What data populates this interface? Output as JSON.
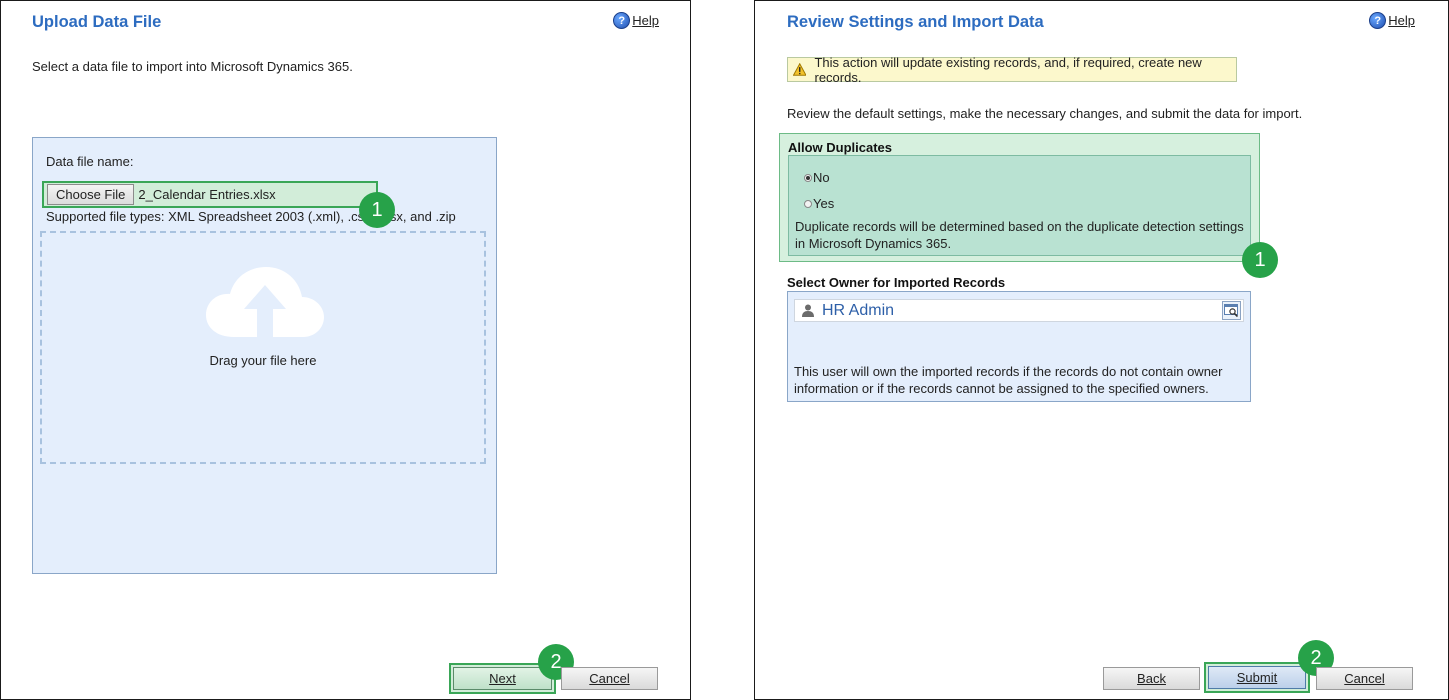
{
  "left": {
    "title": "Upload Data File",
    "help_label": "Help",
    "instruction": "Select a data file to import into Microsoft Dynamics 365.",
    "file_label": "Data file name:",
    "choose_file_label": "Choose File",
    "file_name": "2_Calendar Entries.xlsx",
    "supported_types": "Supported file types: XML Spreadsheet 2003 (.xml), .csv, .xlsx, and .zip",
    "drag_text": "Drag your file here",
    "next_label": "Next",
    "cancel_label": "Cancel",
    "badge_1": "1",
    "badge_2": "2"
  },
  "right": {
    "title": "Review Settings and Import Data",
    "help_label": "Help",
    "warning": "This action will update existing records, and, if required, create new records.",
    "instruction": "Review the default settings, make the necessary changes, and submit the data for import.",
    "allow_duplicates_heading": "Allow Duplicates",
    "option_no": "No",
    "option_yes": "Yes",
    "selected_option": "No",
    "duplicates_desc": "Duplicate records will be determined based on the duplicate detection settings in Microsoft Dynamics 365.",
    "owner_heading": "Select Owner for Imported Records",
    "owner_name": "HR Admin",
    "owner_desc": "This user will own the imported records if the records do not contain owner information or if the records cannot be assigned to the specified owners.",
    "back_label": "Back",
    "submit_label": "Submit",
    "cancel_label": "Cancel",
    "badge_1": "1",
    "badge_2": "2"
  },
  "colors": {
    "title_blue": "#2d6cc0",
    "highlight_green": "#3aa657",
    "badge_green": "#27a249",
    "panel_bg": "#e4eefc"
  }
}
